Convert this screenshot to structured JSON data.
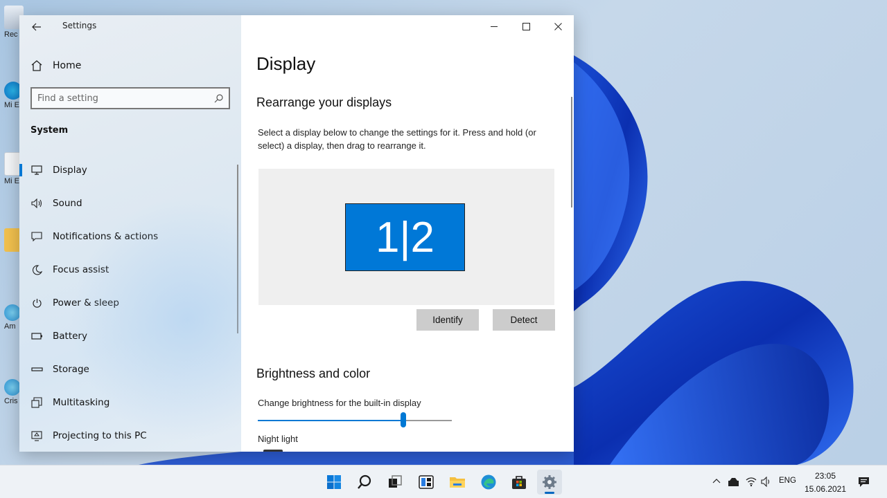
{
  "window": {
    "app_title": "Settings",
    "controls": {
      "minimize_icon": "minimize-icon",
      "maximize_icon": "maximize-icon",
      "close_icon": "close-icon"
    }
  },
  "sidebar": {
    "home_label": "Home",
    "search_placeholder": "Find a setting",
    "section_label": "System",
    "items": [
      {
        "label": "Display",
        "icon": "monitor-icon",
        "active": true
      },
      {
        "label": "Sound",
        "icon": "speaker-icon"
      },
      {
        "label": "Notifications & actions",
        "icon": "notification-icon"
      },
      {
        "label": "Focus assist",
        "icon": "moon-icon"
      },
      {
        "label": "Power & sleep",
        "icon": "power-icon"
      },
      {
        "label": "Battery",
        "icon": "battery-icon"
      },
      {
        "label": "Storage",
        "icon": "storage-icon"
      },
      {
        "label": "Multitasking",
        "icon": "multitasking-icon"
      },
      {
        "label": "Projecting to this PC",
        "icon": "projecting-icon"
      }
    ]
  },
  "content": {
    "page_title": "Display",
    "rearrange_heading": "Rearrange your displays",
    "rearrange_desc": "Select a display below to change the settings for it. Press and hold (or select) a display, then drag to rearrange it.",
    "monitor_label": "1|2",
    "identify_label": "Identify",
    "detect_label": "Detect",
    "brightness_heading": "Brightness and color",
    "brightness_label": "Change brightness for the built-in display",
    "brightness_value": 0.75,
    "night_light_label": "Night light"
  },
  "desktop": {
    "icons": [
      "Rec",
      "Mi Edg",
      "Mi E",
      "",
      "Am",
      "Cris Kr"
    ]
  },
  "taskbar": {
    "apps": [
      "start-icon",
      "search-icon",
      "task-view-icon",
      "widgets-icon",
      "file-explorer-icon",
      "edge-icon",
      "store-icon",
      "settings-icon"
    ],
    "tray": {
      "language": "ENG",
      "time": "23:05",
      "date": "15.06.2021"
    }
  },
  "colors": {
    "accent": "#0078d4",
    "monitor": "#0078d7"
  }
}
